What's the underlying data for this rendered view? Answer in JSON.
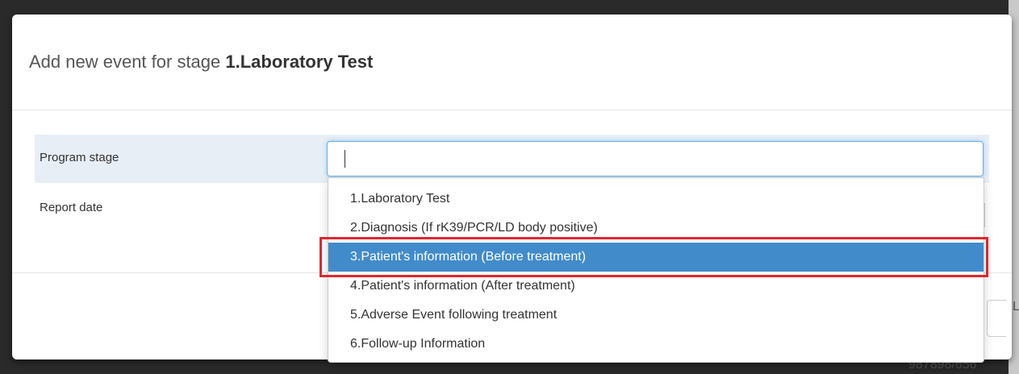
{
  "modal": {
    "title_prefix": "Add new event for stage ",
    "title_stage": "1.Laboratory Test"
  },
  "form": {
    "program_stage_label": "Program stage",
    "program_stage_value": "",
    "report_date_label": "Report date"
  },
  "dropdown": {
    "options": [
      {
        "label": "1.Laboratory Test",
        "selected": false
      },
      {
        "label": "2.Diagnosis (If rK39/PCR/LD body positive)",
        "selected": false
      },
      {
        "label": "3.Patient's information (Before treatment)",
        "selected": true
      },
      {
        "label": "4.Patient's information (After treatment)",
        "selected": false
      },
      {
        "label": "5.Adverse Event following treatment",
        "selected": false
      },
      {
        "label": "6.Follow-up Information",
        "selected": false
      }
    ]
  },
  "background": {
    "partial_number": "987898/656",
    "partial_letter": "L"
  },
  "colors": {
    "selected_bg": "#428bca",
    "highlight_border": "#e0262e",
    "row_highlight": "#e8eef6"
  }
}
